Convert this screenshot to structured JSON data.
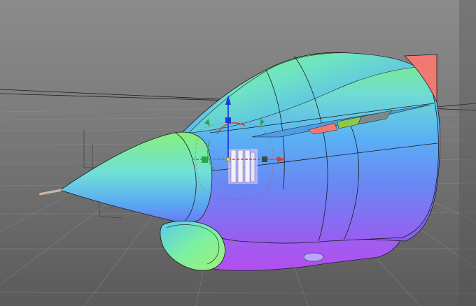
{
  "viewport": {
    "kind": "3d-modeling-viewport",
    "shading": "normal-map",
    "background_top": "#8b8b8b",
    "background_bottom": "#5a5a5a",
    "grid_color": "#9a9a9a",
    "wire_color": "#1a1a1a"
  },
  "model": {
    "name_icon": "aircraft-nose-mesh",
    "colors": {
      "green": "#7cf07a",
      "cyan": "#6fd6f2",
      "blue": "#5a9af4",
      "purple": "#8a5cf0",
      "violet": "#b05cf0",
      "red": "#f07a72"
    }
  },
  "gizmo": {
    "icon": "transform-gizmo-icon",
    "axis_y_color": "#1a3bd9",
    "axis_x_color": "#e03a2a",
    "axis_z_color": "#2aa64a"
  }
}
